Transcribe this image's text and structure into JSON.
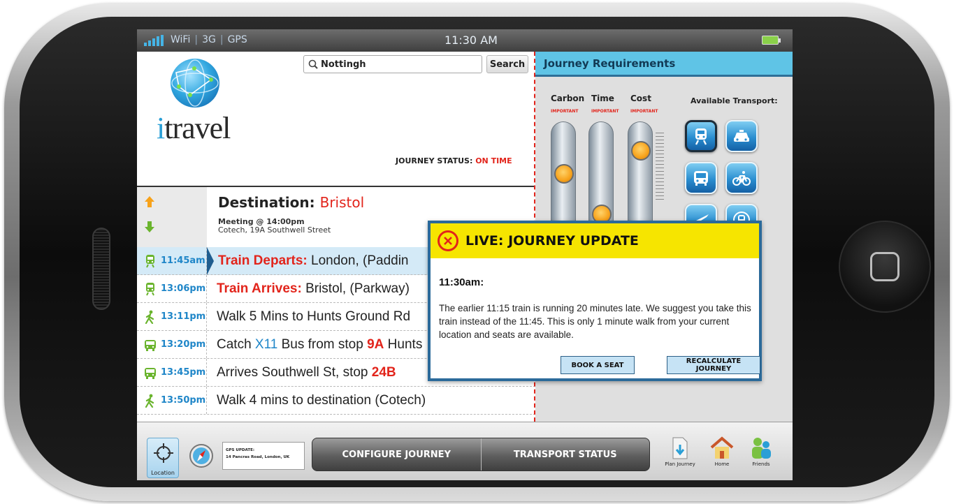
{
  "status_bar": {
    "network_wifi": "WiFi",
    "network_3g": "3G",
    "network_gps": "GPS",
    "time": "11:30 AM"
  },
  "app": {
    "logo_i": "i",
    "logo_rest": "travel"
  },
  "search": {
    "value": "Nottingh",
    "button_label": "Search"
  },
  "journey_status": {
    "label": "JOURNEY STATUS:",
    "value": "ON TIME"
  },
  "destination": {
    "label": "Destination:",
    "place": "Bristol",
    "meeting": "Meeting @ 14:00pm",
    "address": "Cotech, 19A Southwell Street"
  },
  "itinerary": [
    {
      "time": "11:45am",
      "icon": "train-icon",
      "lead": "Train Departs:",
      "text": " London, (Paddin"
    },
    {
      "time": "13:06pm",
      "icon": "train-icon",
      "lead": "Train Arrives:",
      "text": " Bristol, (Parkway)"
    },
    {
      "time": "13:11pm",
      "icon": "walk-icon",
      "text": "Walk 5 Mins to Hunts Ground Rd"
    },
    {
      "time": "13:20pm",
      "icon": "bus-icon",
      "pre": "Catch ",
      "route": "X11",
      "mid": " Bus from stop ",
      "stop": "9A",
      "post": " Hunts"
    },
    {
      "time": "13:45pm",
      "icon": "bus-icon",
      "pre": "Arrives Southwell St, stop ",
      "stop": "24B"
    },
    {
      "time": "13:50pm",
      "icon": "walk-icon",
      "text": "Walk 4 mins to destination (Cotech)"
    }
  ],
  "requirements": {
    "title": "Journey Requirements",
    "sliders": [
      {
        "label": "Carbon",
        "tag": "IMPORTANT",
        "level": 0.35
      },
      {
        "label": "Time",
        "tag": "IMPORTANT",
        "level": 0.7
      },
      {
        "label": "Cost",
        "tag": "IMPORTANT",
        "level": 0.15
      }
    ],
    "transport_title": "Available Transport:",
    "transport_icons": [
      "train-icon",
      "taxi-icon",
      "bus-icon",
      "bicycle-icon",
      "plane-icon",
      "tram-icon"
    ]
  },
  "live_update": {
    "title": "LIVE: JOURNEY UPDATE",
    "time": "11:30am:",
    "body": "The earlier 11:15 train is running 20 minutes late. We suggest you take this train instead of the 11:45. This is only 1 minute walk from your current location and seats are available.",
    "book_label": "BOOK A SEAT",
    "recalc_label": "RECALCULATE JOURNEY"
  },
  "toolbar": {
    "location_label": "Location",
    "gps_title": "GPS UPDATE:",
    "gps_address": "14 Pancras Road, London, UK",
    "configure_label": "CONFIGURE JOURNEY",
    "transport_status_label": "TRANSPORT STATUS",
    "plan_label": "Plan Journey",
    "home_label": "Home",
    "friends_label": "Friends"
  },
  "colors": {
    "accent_blue": "#1f86c8",
    "alert_red": "#e2241b",
    "header_cyan": "#5fc4e6",
    "popup_yellow": "#f6e500"
  }
}
